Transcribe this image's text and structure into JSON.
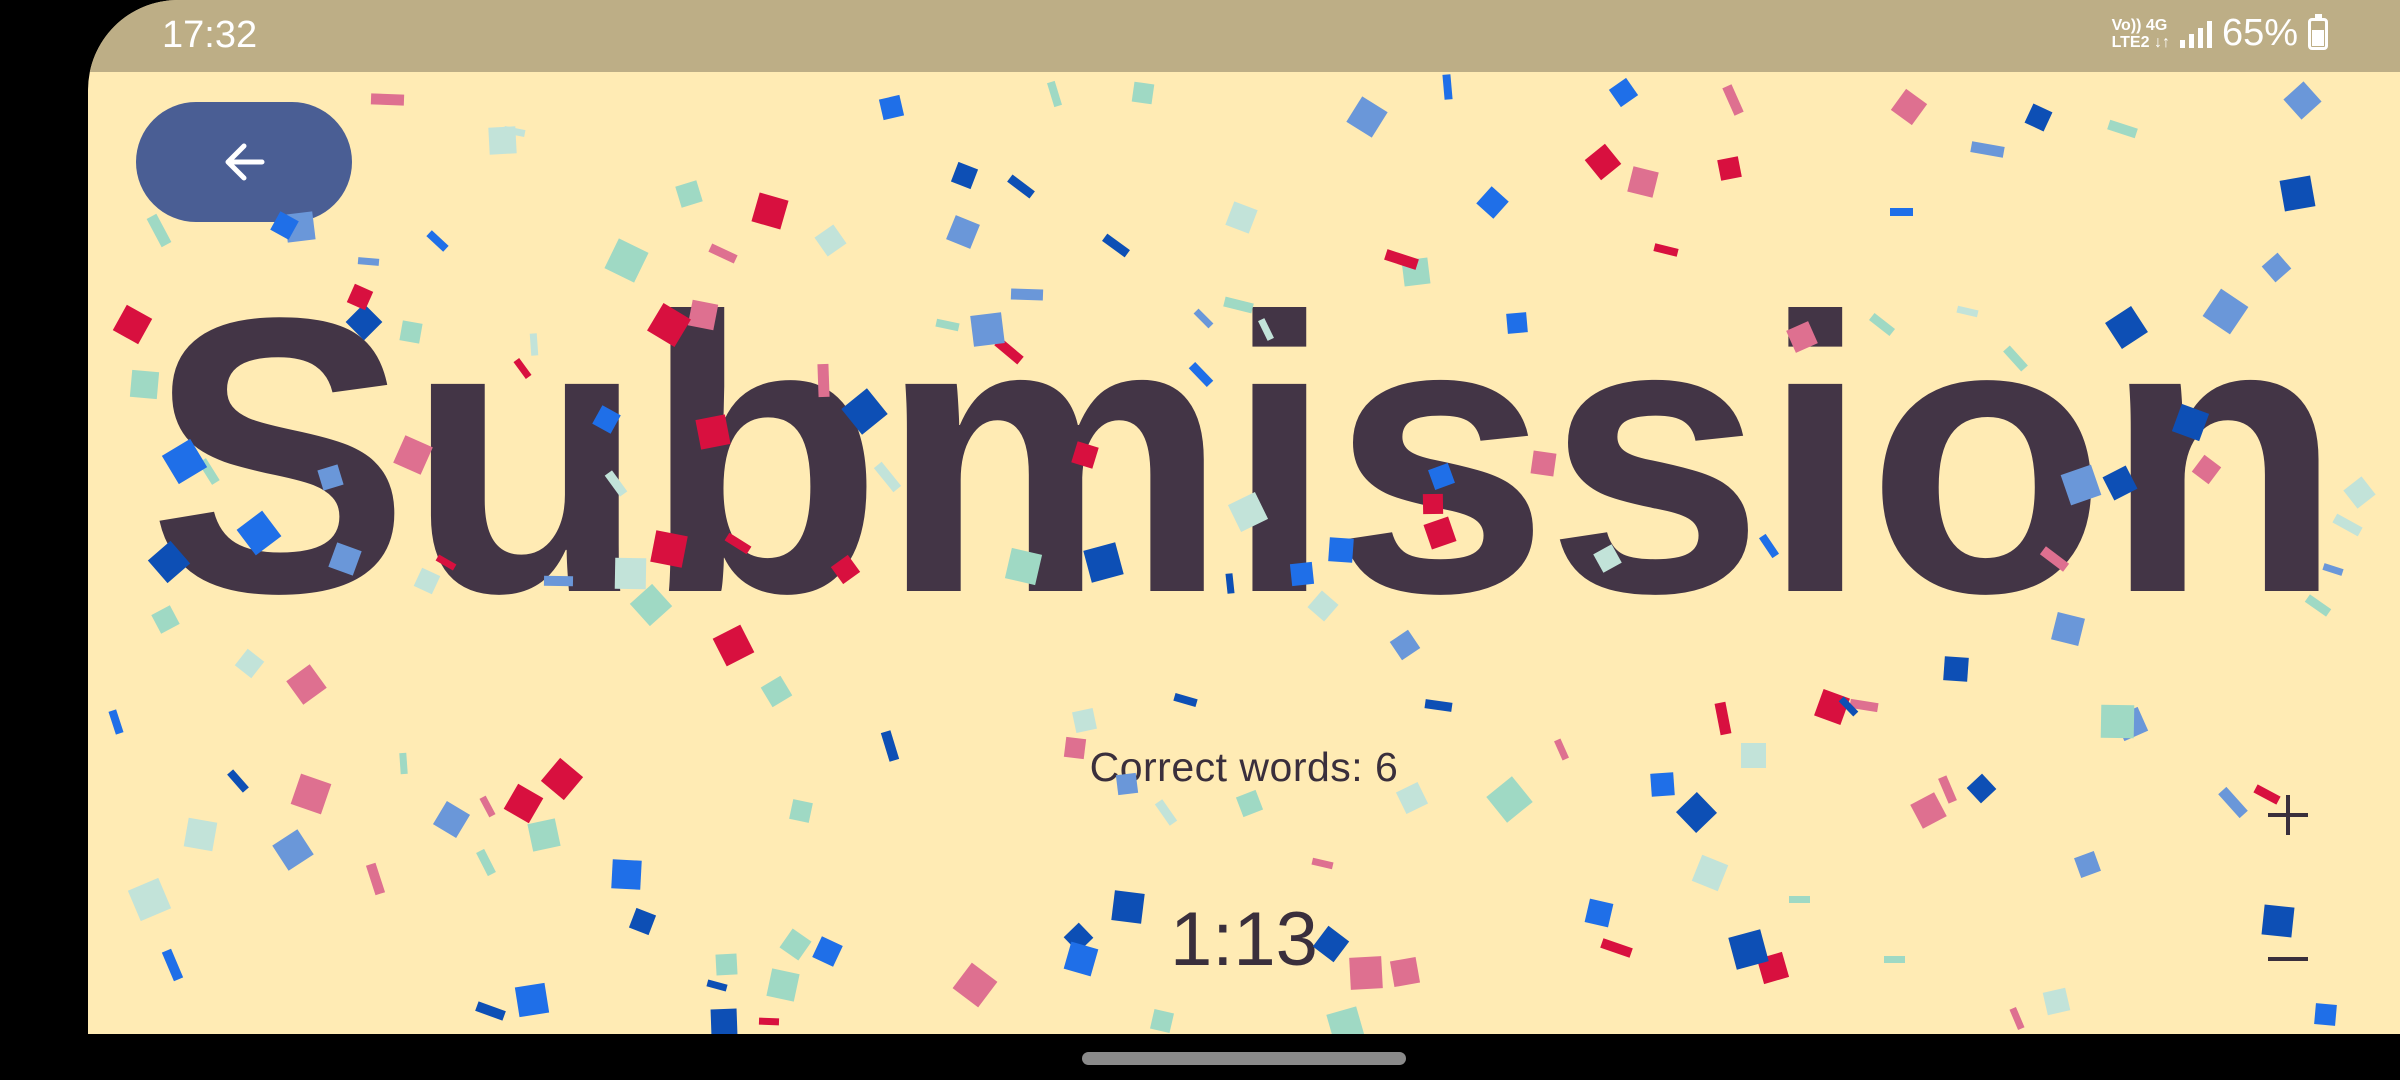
{
  "status_bar": {
    "time": "17:32",
    "network_top": "Vo)) 4G",
    "network_bottom": "LTE2 ↓↑",
    "battery": "65%"
  },
  "back_button": {
    "icon": "arrow-left-icon"
  },
  "title": "Submission",
  "score": {
    "text": "Correct words: 6"
  },
  "timer": "1:13",
  "controls": {
    "plus_icon": "plus-icon",
    "minus_icon": "minus-icon"
  },
  "colors": {
    "background": "#FFEBB4",
    "status_bar": "#BDAE86",
    "accent": "#4A5E94",
    "title_text": "#433546",
    "confetti": [
      "#D8103F",
      "#1F6FE8",
      "#6A97D9",
      "#0D4FB5",
      "#9FD9C4",
      "#DE7090",
      "#C2E3D9"
    ]
  }
}
